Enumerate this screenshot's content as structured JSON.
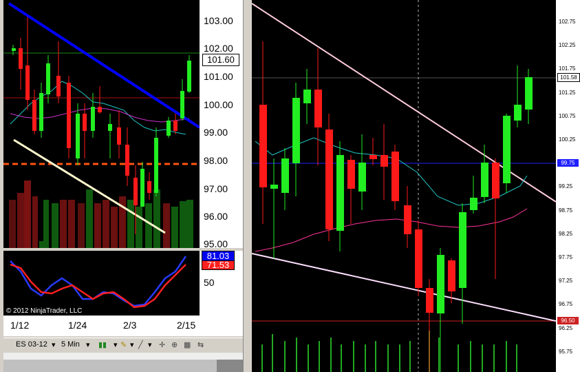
{
  "left": {
    "price_ticks": [
      "103.00",
      "102.00",
      "101.00",
      "100.00",
      "99.00",
      "98.00",
      "97.00",
      "96.00",
      "95.00"
    ],
    "last_price": "101.60",
    "osc_values": [
      "81.03",
      "71.53"
    ],
    "osc_tick": "50",
    "date_ticks": [
      "1/12",
      "1/24",
      "2/3",
      "2/15"
    ],
    "copyright": "© 2012 NinjaTrader, LLC"
  },
  "toolbar": {
    "instrument": "ES 03-12",
    "interval": "5 Min"
  },
  "right": {
    "price_ticks": [
      "102.75",
      "102.25",
      "101.75",
      "101.25",
      "100.75",
      "100.25",
      "99.75",
      "99.25",
      "98.75",
      "98.25",
      "97.75",
      "97.25",
      "96.75",
      "96.25",
      "95.75"
    ],
    "last_price": "101.58",
    "blue_line_price": "99.75",
    "red_line_price": "96.50"
  },
  "colors": {
    "up": "#22ee22",
    "down": "#ff1a1a",
    "trend_blue": "#0000ff",
    "trend_white": "#fff8cc",
    "blue_level": "#2020ff",
    "red_level": "#cc2222"
  }
}
